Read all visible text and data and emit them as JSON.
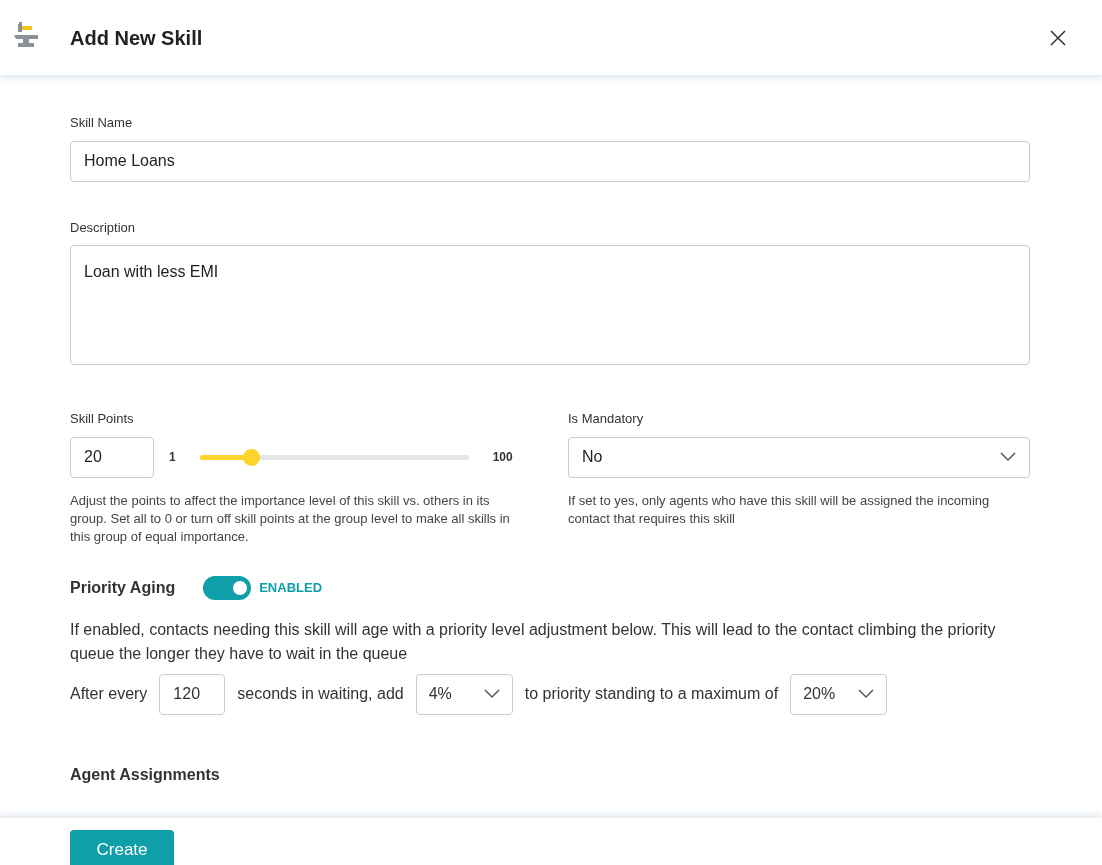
{
  "dialog": {
    "title": "Add New Skill"
  },
  "skill_name": {
    "label": "Skill Name",
    "value": "Home Loans"
  },
  "description": {
    "label": "Description",
    "value": "Loan with less EMI"
  },
  "skill_points": {
    "label": "Skill Points",
    "value": "20",
    "min_label": "1",
    "max_label": "100",
    "level": 0.19,
    "help": "Adjust the points to affect the importance level of this skill vs. others in its group. Set all to 0 or turn off skill points at the group level to make all skills in this group of equal importance."
  },
  "is_mandatory": {
    "label": "Is Mandatory",
    "value": "No",
    "help": "If set to yes, only agents who have this skill will be assigned the incoming contact that requires this skill"
  },
  "priority_aging": {
    "label": "Priority Aging",
    "on": true,
    "status": "ENABLED",
    "help": "If enabled, contacts needing this skill will age with a priority level adjustment below. This will lead to the contact climbing the priority queue the longer they have to wait in the queue",
    "sentence": [
      {
        "kind": "text",
        "text": "After every"
      },
      {
        "kind": "input",
        "value": "120"
      },
      {
        "kind": "text",
        "text": "seconds in waiting, add"
      },
      {
        "kind": "select",
        "value": "4%"
      },
      {
        "kind": "text",
        "text": "to priority standing to a maximum of"
      },
      {
        "kind": "select",
        "value": "20%"
      }
    ]
  },
  "agent_assignments": {
    "title": "Agent Assignments"
  },
  "buttons": [
    {
      "label": "Create"
    }
  ]
}
